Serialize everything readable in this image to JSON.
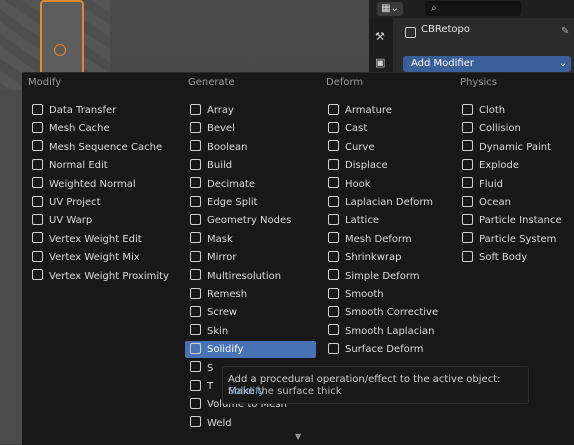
{
  "properties": {
    "search_icon": "search-icon",
    "object_name": "CBRetopo",
    "add_modifier_label": "Add Modifier",
    "add_modifier_chevron": "⌄"
  },
  "menu": {
    "columns": {
      "modify": "Modify",
      "generate": "Generate",
      "deform": "Deform",
      "physics": "Physics"
    },
    "modify": [
      "Data Transfer",
      "Mesh Cache",
      "Mesh Sequence Cache",
      "Normal Edit",
      "Weighted Normal",
      "UV Project",
      "UV Warp",
      "Vertex Weight Edit",
      "Vertex Weight Mix",
      "Vertex Weight Proximity"
    ],
    "generate": [
      "Array",
      "Bevel",
      "Boolean",
      "Build",
      "Decimate",
      "Edge Split",
      "Geometry Nodes",
      "Mask",
      "Mirror",
      "Multiresolution",
      "Remesh",
      "Screw",
      "Skin",
      "Solidify",
      "S",
      "T",
      "Volume to Mesh",
      "Weld"
    ],
    "deform": [
      "Armature",
      "Cast",
      "Curve",
      "Displace",
      "Hook",
      "Laplacian Deform",
      "Lattice",
      "Mesh Deform",
      "Shrinkwrap",
      "Simple Deform",
      "Smooth",
      "Smooth Corrective",
      "Smooth Laplacian",
      "Surface Deform"
    ],
    "physics": [
      "Cloth",
      "Collision",
      "Dynamic Paint",
      "Explode",
      "Fluid",
      "Ocean",
      "Particle Instance",
      "Particle System",
      "Soft Body"
    ],
    "highlighted": "Solidify"
  },
  "tooltip": {
    "line1_prefix": "Add a procedural operation/effect to the active object:",
    "line1_accent": "Solidify",
    "line2": "Make the surface thick"
  },
  "colors": {
    "accent": "#4772b3",
    "menu_bg": "#181818",
    "selection": "#e08a2c"
  }
}
